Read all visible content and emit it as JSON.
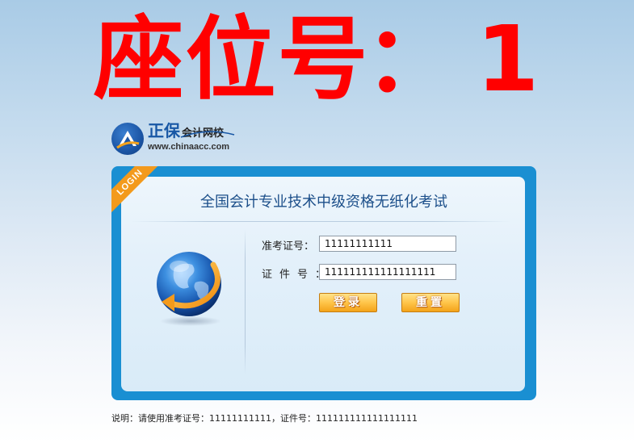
{
  "seat": {
    "label": "座位号",
    "separator": "：",
    "number": "1"
  },
  "logo": {
    "brand": "正保",
    "brand_sub": "会计网校",
    "url": "www.chinaacc.com"
  },
  "panel": {
    "ribbon": "LOGIN",
    "title": "全国会计专业技术中级资格无纸化考试",
    "exam_label": "准考证号：",
    "exam_value": "11111111111",
    "id_label": "证件号：",
    "id_value": "111111111111111111",
    "login_button": "登录",
    "reset_button": "重置"
  },
  "note": "说明：请使用准考证号：11111111111，证件号：111111111111111111",
  "colors": {
    "seat_red": "#ff0000",
    "panel_blue": "#1a8fd2",
    "ribbon_orange": "#f39a1c",
    "button_orange": "#ffc54a"
  },
  "icons": {
    "logo": "chinaacc-logo-icon",
    "globe": "globe-arrow-icon"
  }
}
